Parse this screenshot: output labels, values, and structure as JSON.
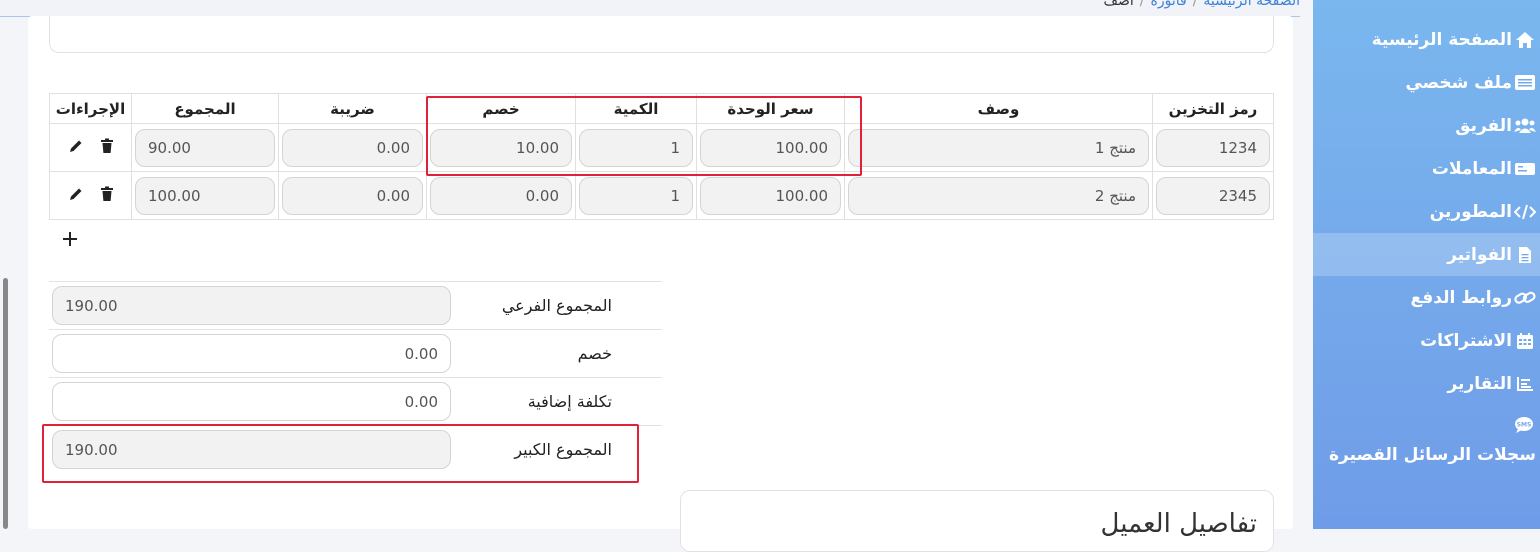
{
  "breadcrumb": {
    "home": "الصفحة الرئيسية",
    "invoice": "فاتورة",
    "current": "أضف",
    "separator": "/"
  },
  "items_table": {
    "headers": {
      "sku": "رمز التخزين",
      "description": "وصف",
      "unit_price": "سعر الوحدة",
      "quantity": "الكمية",
      "discount": "خصم",
      "tax": "ضريبة",
      "total": "المجموع",
      "actions": "الإجراءات"
    },
    "rows": [
      {
        "sku": "1234",
        "description": "منتج 1",
        "unit_price": "100.00",
        "quantity": "1",
        "discount": "10.00",
        "tax": "0.00",
        "total": "90.00"
      },
      {
        "sku": "2345",
        "description": "منتج 2",
        "unit_price": "100.00",
        "quantity": "1",
        "discount": "0.00",
        "tax": "0.00",
        "total": "100.00"
      }
    ]
  },
  "totals": {
    "subtotal_label": "المجموع الفرعي",
    "subtotal": "190.00",
    "discount_label": "خصم",
    "discount": "0.00",
    "extra_cost_label": "تكلفة إضافية",
    "extra_cost": "0.00",
    "grand_total_label": "المجموع الكبير",
    "grand_total": "190.00"
  },
  "customer_details": {
    "title": "تفاصيل العميل"
  },
  "sidebar": {
    "items": [
      {
        "label": "الصفحة الرئيسية",
        "icon": "home-icon"
      },
      {
        "label": "ملف شخصي",
        "icon": "profile-card-icon"
      },
      {
        "label": "الفريق",
        "icon": "users-icon"
      },
      {
        "label": "المعاملات",
        "icon": "transactions-icon"
      },
      {
        "label": "المطورين",
        "icon": "code-icon"
      },
      {
        "label": "الفواتير",
        "icon": "invoice-icon",
        "active": true
      },
      {
        "label": "روابط الدفع",
        "icon": "link-icon"
      },
      {
        "label": "الاشتراكات",
        "icon": "calendar-icon"
      },
      {
        "label": "التقارير",
        "icon": "chart-icon"
      },
      {
        "label": "سجلات الرسائل القصيرة",
        "icon": "sms-icon"
      }
    ]
  },
  "colors": {
    "sidebar": "#74a8eb",
    "highlight": "#e0213a",
    "link": "#3b82d6"
  }
}
